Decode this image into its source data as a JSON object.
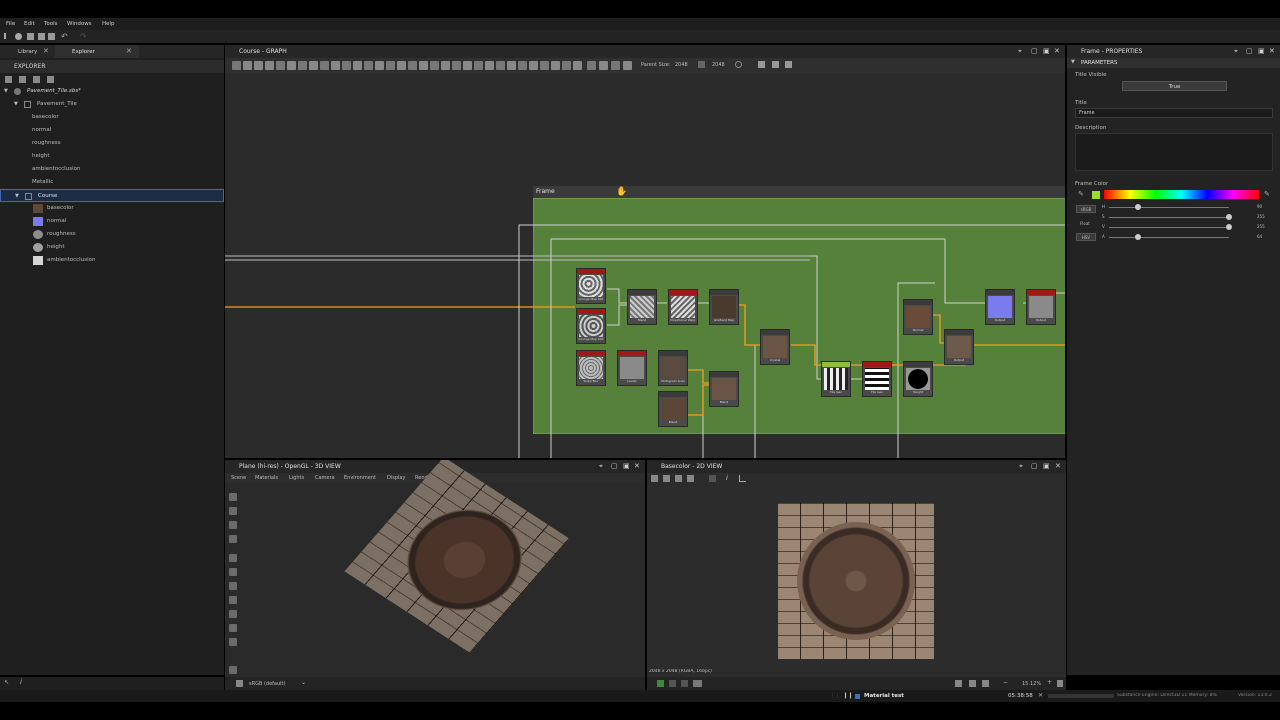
{
  "menu": [
    "File",
    "Edit",
    "Tools",
    "Windows",
    "Help"
  ],
  "left_tabs": {
    "library": "Library",
    "explorer": "Explorer"
  },
  "explorer": {
    "title": "EXPLORER",
    "package": "Pavement_Tile.sbs*",
    "graph1": "Pavement_Tile",
    "graph1_outputs": [
      "basecolor",
      "normal",
      "roughness",
      "height",
      "ambientocclusion",
      "Metallic"
    ],
    "graph2": "Course",
    "graph2_outputs": [
      "basecolor",
      "normal",
      "roughness",
      "height",
      "ambientocclusion"
    ]
  },
  "graph": {
    "title": "Course - GRAPH",
    "parent_size_label": "Parent Size:",
    "parent_size_1": "2048",
    "parent_size_2": "2048",
    "frame_title": "Frame"
  },
  "properties": {
    "title": "Frame - PROPERTIES",
    "section": "PARAMETERS",
    "title_visible_label": "Title Visible",
    "title_visible_value": "True",
    "title_label": "Title",
    "title_value": "Frame",
    "description_label": "Description",
    "frame_color_label": "Frame Color",
    "color_modes": [
      "sRGB",
      "Float",
      "HSV"
    ],
    "slider_labels": [
      "H",
      "S",
      "V",
      "A"
    ],
    "slider_values": [
      "90",
      "255",
      "255",
      "64"
    ],
    "color_accent": "#9bdc2a"
  },
  "view3d": {
    "title": "Plane (hi-res) - OpenGL - 3D VIEW",
    "menu": [
      "Scene",
      "Materials",
      "Lights",
      "Camera",
      "Environment",
      "Display",
      "Renderer"
    ],
    "colorspace": "sRGB (default)"
  },
  "view2d": {
    "title": "Basecolor - 2D VIEW",
    "info": "2048 x 2048 (RGBA, 16bpc)",
    "zoom": "15.12%"
  },
  "statusbar": {
    "material": "Material test",
    "time": "05:38:58",
    "engine": "Substance Engine: Direct3D 11  Memory: 8%",
    "version": "Version: 13.0.2"
  },
  "node_labels": [
    "Grunge Map 001",
    "Grunge Map 002",
    "Blend",
    "Directional Warp",
    "Gradient Map",
    "Slope Blur",
    "Levels",
    "Histogram Scan",
    "Blend",
    "Blend",
    "Crystal",
    "Tile Gen",
    "Tile Gen",
    "Height",
    "Normal",
    "Output",
    "Output"
  ]
}
